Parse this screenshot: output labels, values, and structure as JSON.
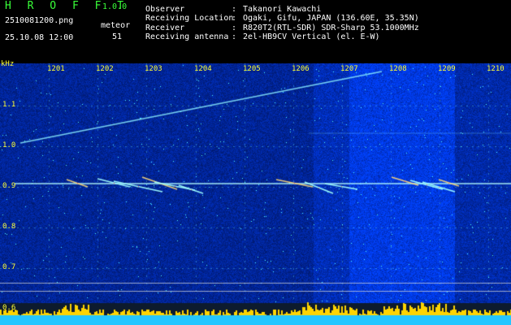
{
  "app": {
    "title": "H R O F F T",
    "version": "1.0.0"
  },
  "file": {
    "name": "2510081200.png",
    "datetime": "25.10.08 12:00"
  },
  "meteor": {
    "label": "meteor",
    "count": "51"
  },
  "station": {
    "rows": [
      {
        "label": "Observer",
        "value": "Takanori Kawachi"
      },
      {
        "label": "Receiving Location",
        "value": "Ogaki, Gifu, JAPAN (136.60E, 35.35N)"
      },
      {
        "label": "Receiver",
        "value": "R820T2(RTL-SDR) SDR-Sharp 53.1000MHz"
      },
      {
        "label": "Receiving antenna",
        "value": "2el-HB9CV Vertical (el. E-W)"
      }
    ]
  },
  "axis": {
    "y_unit": "kHz",
    "y_ticks": [
      "1.1",
      "1.0",
      "0.9",
      "0.8",
      "0.7",
      "0.6"
    ],
    "x_ticks": [
      "1201",
      "1202",
      "1203",
      "1204",
      "1205",
      "1206",
      "1207",
      "1208",
      "1209",
      "1210"
    ]
  },
  "colors": {
    "background": "#000000",
    "noise_base": "#0a1280",
    "accent_text": "#ffff33",
    "title_text": "#39ff39",
    "signal": "#7fffff",
    "bottom_bar": "#23c6ff",
    "bottom_spike": "#ffd400"
  }
}
